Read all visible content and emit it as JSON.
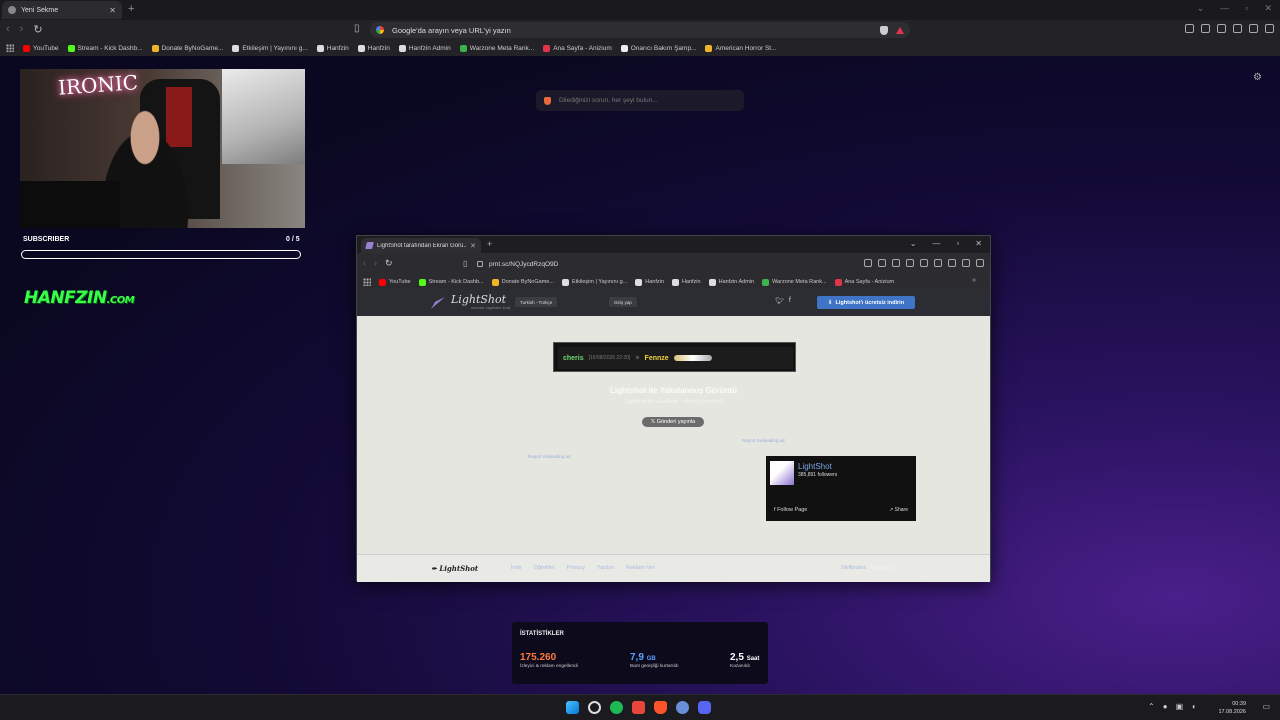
{
  "outer_browser": {
    "tab_title": "Yeni Sekme",
    "address_placeholder": "Google'da arayın veya URL'yi yazın",
    "bookmarks": [
      {
        "label": "YouTube",
        "color": "#ff0000"
      },
      {
        "label": "Stream - Kick Dashb...",
        "color": "#53fc18"
      },
      {
        "label": "Donate ByNoGame...",
        "color": "#f0b429"
      },
      {
        "label": "Etkileşim | Yayınını g...",
        "color": "#dddddd"
      },
      {
        "label": "Hanfzin",
        "color": "#dddddd"
      },
      {
        "label": "Hanfzin",
        "color": "#dddddd"
      },
      {
        "label": "Hanfzin Admin",
        "color": "#dddddd"
      },
      {
        "label": "Warzone Meta Rank...",
        "color": "#3cb34a"
      },
      {
        "label": "Ana Sayfa - Anizium",
        "color": "#e0354a"
      },
      {
        "label": "Onarıcı Bakım Şamp...",
        "color": "#eeeeee"
      },
      {
        "label": "American Horror St...",
        "color": "#f0b429"
      }
    ]
  },
  "newtab": {
    "search_placeholder": "Dilediğinizi sorun, her şeyi bulun..."
  },
  "overlay": {
    "neon_text": "IRONIC",
    "subscriber_label": "SUBSCRIBER",
    "subscriber_count": "0 / 5",
    "subscriber_progress": 0,
    "brand": "HANFZIN",
    "brand_suffix": ".COM",
    "brand_color": "#39ff4a"
  },
  "inner_browser": {
    "tab_title": "LightShot tarafından Ekran Görü...",
    "url": "prnt.sc/NQJycdRzqO9D",
    "bookmarks": [
      {
        "label": "YouTube",
        "color": "#ff0000"
      },
      {
        "label": "Stream - Kick Dashb...",
        "color": "#53fc18"
      },
      {
        "label": "Donate ByNoGame...",
        "color": "#f0b429"
      },
      {
        "label": "Etkileşim | Yayınını g...",
        "color": "#dddddd"
      },
      {
        "label": "Hanfzin",
        "color": "#dddddd"
      },
      {
        "label": "Hanfzin",
        "color": "#dddddd"
      },
      {
        "label": "Hanfzin Admin",
        "color": "#dddddd"
      },
      {
        "label": "Warzone Meta Rank...",
        "color": "#3cb34a"
      },
      {
        "label": "Ana Sayfa - Anizium",
        "color": "#e0354a"
      }
    ]
  },
  "lightshot": {
    "logo": "LightShot",
    "logo_tagline": "screen capture tool",
    "language": "Turkish - Türkçe",
    "login": "Giriş yap",
    "download_button": "Lightshot'ı ücretsiz indirin",
    "screenshot": {
      "user": "cheris",
      "date": "[16/08/2026 22:30]",
      "victim": "Fennze"
    },
    "faint_title": "Lightshot ile Yakalanmış Görüntü",
    "faint_subtitle": "Lightshot ile yakalandı · ekran görüntüsü",
    "tweet_button": "Gönderi yayınla",
    "report_right": "Report misleading ad",
    "report_left": "Report misleading ad",
    "fb": {
      "name": "LightShot",
      "followers": "385,891 followers",
      "follow": "Follow Page",
      "share": "Share"
    },
    "footer": {
      "logo": "LightShot",
      "links": [
        "İndir",
        "Öğretiler",
        "Privacy",
        "Yardım",
        "Reklam Ver"
      ],
      "right_prefix": "Skillbrains",
      "right_suffix": "· Lightshot"
    }
  },
  "stats": {
    "title": "İSTATİSTİKLER",
    "items": [
      {
        "value": "175.260",
        "unit": "",
        "label": "İzleyici & reklam engellendi",
        "color": "#ff7a3d"
      },
      {
        "value": "7,9",
        "unit": "GB",
        "label": "Bant genişliği kurtarıldı",
        "color": "#5aa2ff"
      },
      {
        "value": "2,5",
        "unit": "Saat",
        "label": "Kazanıldı",
        "color": "#ffffff"
      }
    ]
  },
  "taskbar": {
    "time": "00:39",
    "date": "17.08.2026"
  }
}
